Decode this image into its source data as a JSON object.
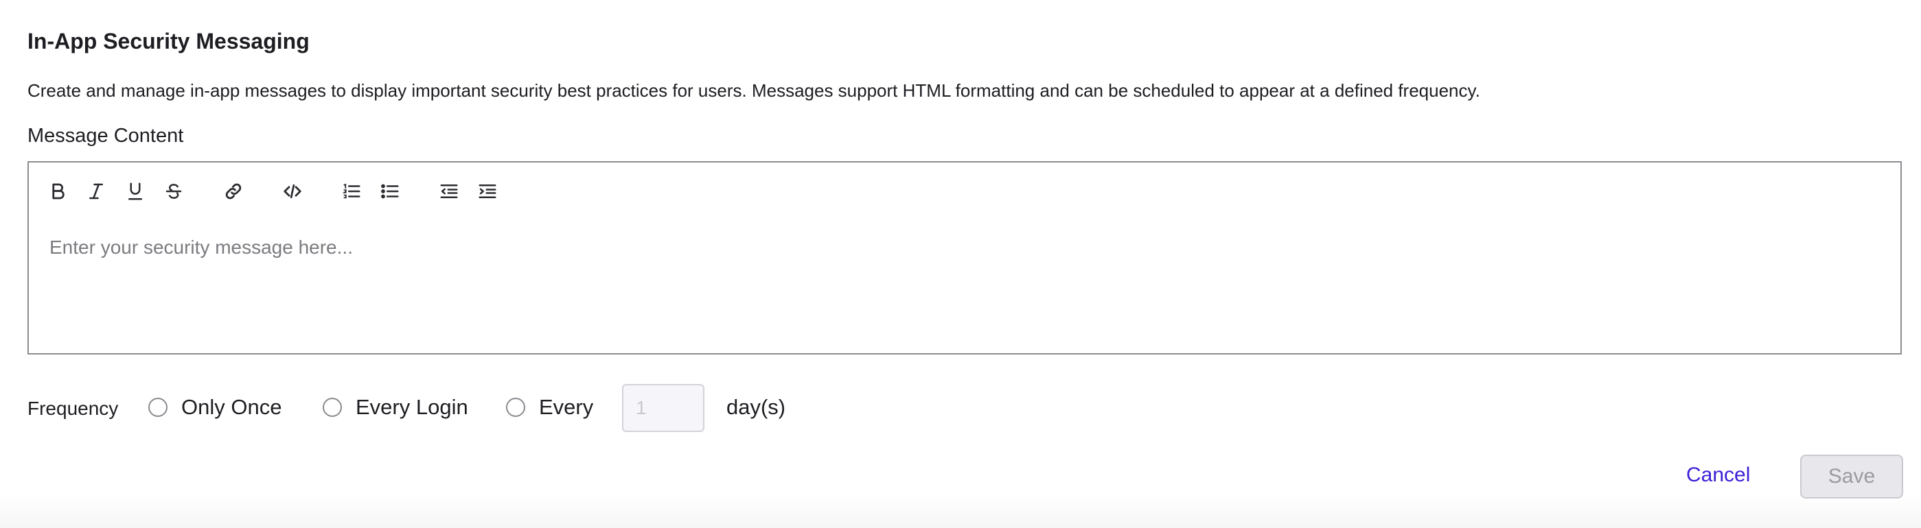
{
  "header": {
    "title": "In-App Security Messaging",
    "description": "Create and manage in-app messages to display important security best practices for users. Messages support HTML formatting and can be scheduled to appear at a defined frequency."
  },
  "editor": {
    "label": "Message Content",
    "placeholder": "Enter your security message here...",
    "toolbar": [
      "bold-icon",
      "italic-icon",
      "underline-icon",
      "strikethrough-icon",
      "link-icon",
      "code-icon",
      "ordered-list-icon",
      "bullet-list-icon",
      "outdent-icon",
      "indent-icon"
    ]
  },
  "frequency": {
    "label": "Frequency",
    "options": [
      {
        "label": "Only Once",
        "selected": false
      },
      {
        "label": "Every Login",
        "selected": false
      },
      {
        "label": "Every",
        "selected": false
      }
    ],
    "days_placeholder": "1",
    "days_suffix": "day(s)"
  },
  "actions": {
    "cancel_label": "Cancel",
    "save_label": "Save"
  },
  "colors": {
    "link": "#3a1fd6",
    "disabled_bg": "#e8e8ec"
  }
}
